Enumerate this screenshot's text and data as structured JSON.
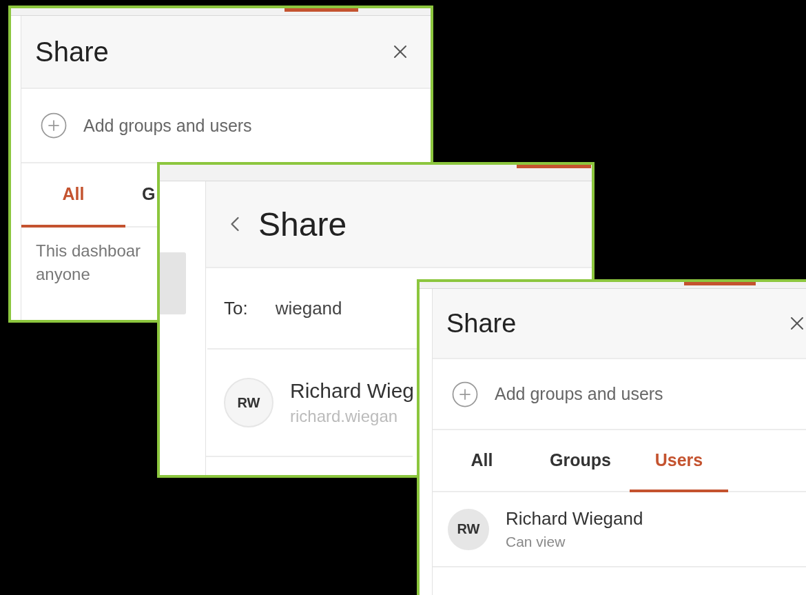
{
  "panels": [
    {
      "kind": "overview",
      "title": "Share",
      "add_label": "Add groups and users",
      "tabs": [
        {
          "label": "All",
          "selected": true
        },
        {
          "label": "G",
          "selected": false
        }
      ],
      "message_lines": [
        "This dashboar",
        "anyone"
      ]
    },
    {
      "kind": "search",
      "title": "Share",
      "to_label": "To:",
      "to_value": "wiegand",
      "results": [
        {
          "initials": "RW",
          "name": "Richard Wieg",
          "email": "richard.wiegan"
        }
      ]
    },
    {
      "kind": "overview",
      "title": "Share",
      "add_label": "Add groups and users",
      "tabs": [
        {
          "label": "All",
          "selected": false
        },
        {
          "label": "Groups",
          "selected": false
        },
        {
          "label": "Users",
          "selected": true
        }
      ],
      "users": [
        {
          "initials": "RW",
          "name": "Richard Wiegand",
          "permission": "Can view"
        }
      ]
    }
  ]
}
